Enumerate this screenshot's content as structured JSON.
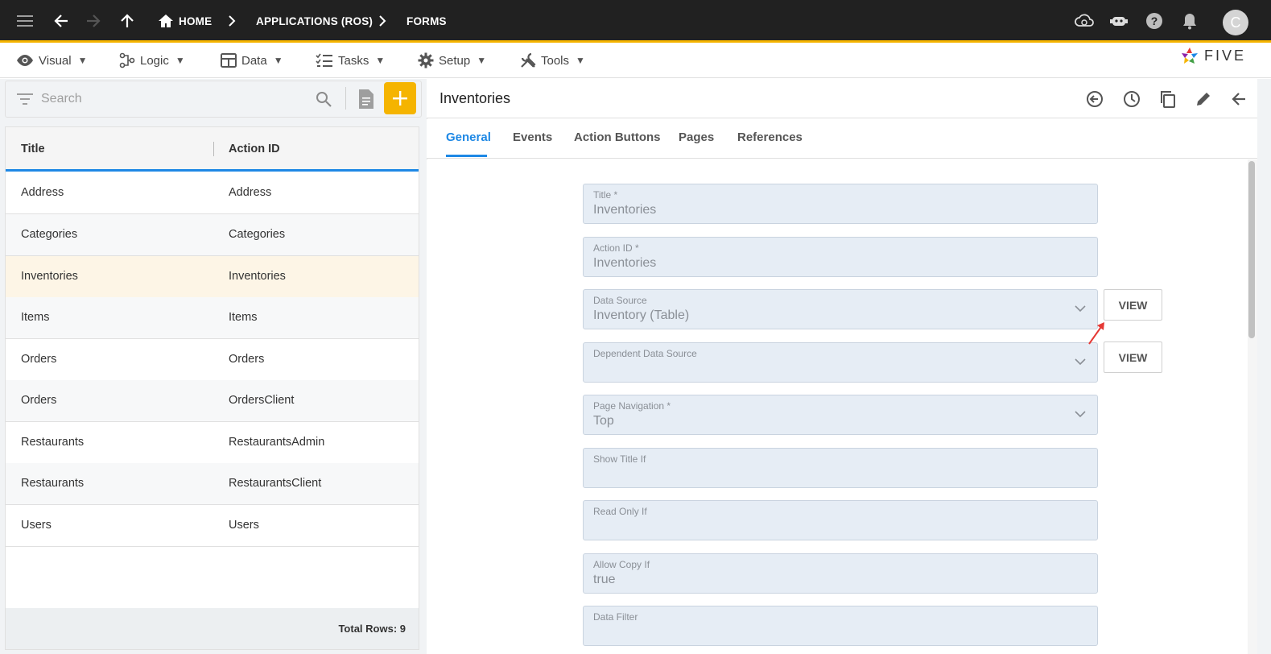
{
  "topbar": {
    "breadcrumbs": [
      "HOME",
      "APPLICATIONS (ROS)",
      "FORMS"
    ],
    "avatar_letter": "C"
  },
  "menu": {
    "items": [
      {
        "label": "Visual",
        "icon": "eye-icon"
      },
      {
        "label": "Logic",
        "icon": "logic-icon"
      },
      {
        "label": "Data",
        "icon": "table-icon"
      },
      {
        "label": "Tasks",
        "icon": "tasks-icon"
      },
      {
        "label": "Setup",
        "icon": "gear-icon"
      },
      {
        "label": "Tools",
        "icon": "tools-icon"
      }
    ],
    "logo_text": "FIVE"
  },
  "list": {
    "search_placeholder": "Search",
    "columns": [
      "Title",
      "Action ID"
    ],
    "rows": [
      {
        "title": "Address",
        "action_id": "Address"
      },
      {
        "title": "Categories",
        "action_id": "Categories"
      },
      {
        "title": "Inventories",
        "action_id": "Inventories"
      },
      {
        "title": "Items",
        "action_id": "Items"
      },
      {
        "title": "Orders",
        "action_id": "Orders"
      },
      {
        "title": "Orders",
        "action_id": "OrdersClient"
      },
      {
        "title": "Restaurants",
        "action_id": "RestaurantsAdmin"
      },
      {
        "title": "Restaurants",
        "action_id": "RestaurantsClient"
      },
      {
        "title": "Users",
        "action_id": "Users"
      }
    ],
    "total_rows": "Total Rows: 9"
  },
  "detail": {
    "title": "Inventories",
    "tabs": [
      "General",
      "Events",
      "Action Buttons",
      "Pages",
      "References"
    ],
    "fields": [
      {
        "label": "Title *",
        "value": "Inventories"
      },
      {
        "label": "Action ID *",
        "value": "Inventories"
      },
      {
        "label": "Data Source",
        "value": "Inventory (Table)"
      },
      {
        "label": "Dependent Data Source",
        "value": ""
      },
      {
        "label": "Page Navigation *",
        "value": "Top"
      },
      {
        "label": "Show Title If",
        "value": ""
      },
      {
        "label": "Read Only If",
        "value": ""
      },
      {
        "label": "Allow Copy If",
        "value": "true"
      },
      {
        "label": "Data Filter",
        "value": ""
      }
    ],
    "view_label": "VIEW"
  },
  "colors": {
    "accent": "#f5b400",
    "link": "#1e88e5",
    "topbar": "#212121"
  }
}
